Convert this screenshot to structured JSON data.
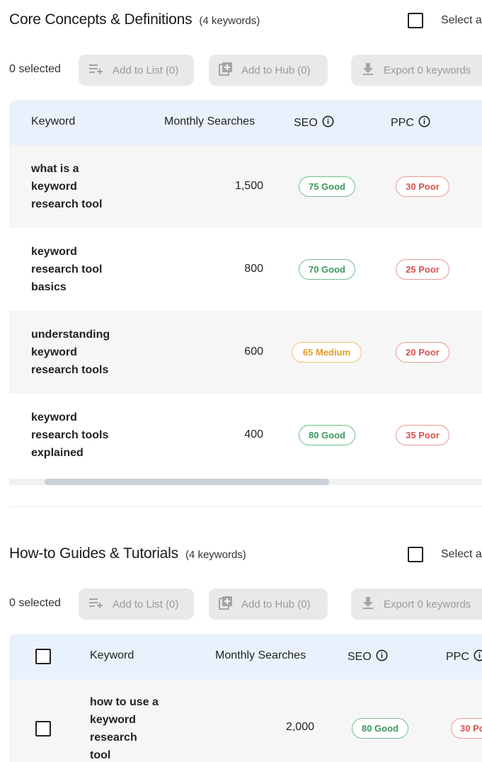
{
  "sections": [
    {
      "title": "Core Concepts & Definitions",
      "count": "(4 keywords)",
      "select_all": "Select a",
      "selected": "0 selected",
      "add_to_list": "Add to List (0)",
      "add_to_hub": "Add to Hub (0)",
      "export": "Export 0 keywords",
      "headers": {
        "keyword": "Keyword",
        "monthly": "Monthly Searches",
        "seo": "SEO",
        "ppc": "PPC"
      },
      "rows": [
        {
          "keyword": "what is a keyword research tool",
          "kw_lines": [
            "what is a",
            "keyword",
            "research tool"
          ],
          "searches": "1,500",
          "seo": "75 Good",
          "seo_level": "good",
          "ppc": "30 Poor",
          "ppc_level": "poor"
        },
        {
          "keyword": "keyword research tool basics",
          "kw_lines": [
            "keyword",
            "research tool",
            "basics"
          ],
          "searches": "800",
          "seo": "70 Good",
          "seo_level": "good",
          "ppc": "25 Poor",
          "ppc_level": "poor"
        },
        {
          "keyword": "understanding keyword research tools",
          "kw_lines": [
            "understanding",
            "keyword",
            "research tools"
          ],
          "searches": "600",
          "seo": "65 Medium",
          "seo_level": "medium",
          "ppc": "20 Poor",
          "ppc_level": "poor"
        },
        {
          "keyword": "keyword research tools explained",
          "kw_lines": [
            "keyword",
            "research tools",
            "explained"
          ],
          "searches": "400",
          "seo": "80 Good",
          "seo_level": "good",
          "ppc": "35 Poor",
          "ppc_level": "poor"
        }
      ]
    },
    {
      "title": "How-to Guides & Tutorials",
      "count": "(4 keywords)",
      "select_all": "Select a",
      "selected": "0 selected",
      "add_to_list": "Add to List (0)",
      "add_to_hub": "Add to Hub (0)",
      "export": "Export 0 keywords",
      "headers": {
        "keyword": "Keyword",
        "monthly": "Monthly Searches",
        "seo": "SEO",
        "ppc": "PPC"
      },
      "rows": [
        {
          "keyword": "how to use a keyword research tool",
          "kw_lines": [
            "how to use a",
            "keyword",
            "research",
            "tool"
          ],
          "searches": "2,000",
          "seo": "80 Good",
          "seo_level": "good",
          "ppc": "30 Po",
          "ppc_level": "poor"
        }
      ]
    }
  ],
  "colors": {
    "header_bg": "#e9f1fc",
    "good": "#3c9a5f",
    "poor": "#d9534f",
    "medium": "#e59a2a"
  }
}
